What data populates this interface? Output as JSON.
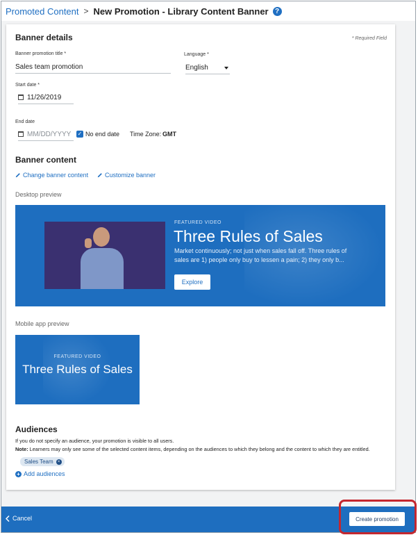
{
  "header": {
    "breadcrumb_parent": "Promoted Content",
    "separator": ">",
    "title": "New Promotion - Library Content Banner",
    "help_icon": "?"
  },
  "banner_details": {
    "section_title": "Banner details",
    "required_note": "* Required Field",
    "title_label": "Banner promotion title *",
    "title_value": "Sales team promotion",
    "language_label": "Language *",
    "language_value": "English",
    "start_label": "Start date *",
    "start_value": "11/26/2019",
    "end_label": "End date",
    "end_placeholder": "MM/DD/YYYY",
    "no_end_date_label": "No end date",
    "no_end_date_checked": true,
    "timezone_label": "Time Zone:",
    "timezone_value": "GMT"
  },
  "banner_content": {
    "section_title": "Banner content",
    "change_link": "Change banner content",
    "customize_link": "Customize banner",
    "desktop_preview_label": "Desktop preview",
    "mobile_preview_label": "Mobile app preview",
    "featured_label": "FEATURED VIDEO",
    "featured_title": "Three Rules of Sales",
    "featured_description": "Market continuously; not just when sales fall off. Three rules of sales are 1) people only buy to lessen a pain; 2) they only b...",
    "explore_button": "Explore"
  },
  "audiences": {
    "section_title": "Audiences",
    "info_text": "If you do not specify an audience, your promotion is visible to all users.",
    "note_label": "Note:",
    "note_text": " Learners may only see some of the selected content items, depending on the audiences to which they belong and the content to which they are entitled.",
    "chip_label": "Sales Team",
    "add_link": "Add audiences"
  },
  "footer": {
    "cancel_label": "Cancel",
    "create_label": "Create promotion"
  },
  "colors": {
    "brand_blue": "#1e6ebf",
    "link_blue": "#1f6fc2",
    "highlight_red": "#c4262e"
  }
}
